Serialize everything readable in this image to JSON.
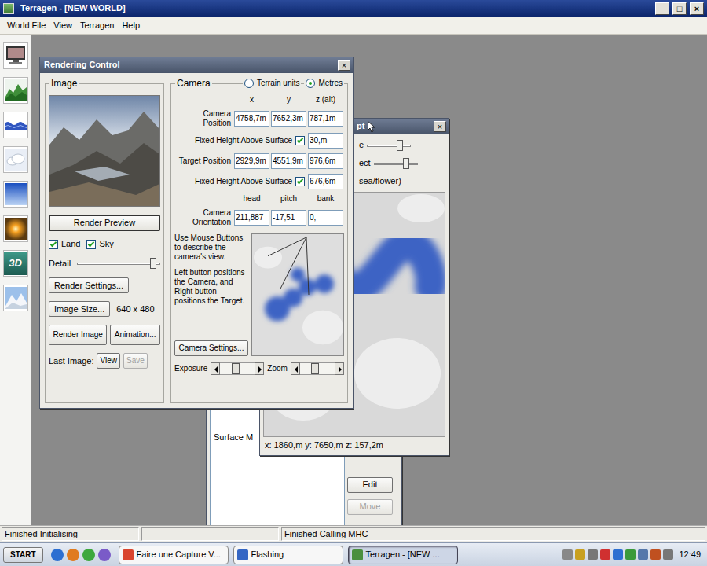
{
  "window": {
    "title": "Terragen - [NEW WORLD]",
    "controls": [
      "_",
      "□",
      "×"
    ]
  },
  "menu": [
    "World File",
    "View",
    "Terragen",
    "Help"
  ],
  "toolbar": [
    {
      "kind": "render"
    },
    {
      "kind": "terrain"
    },
    {
      "kind": "water"
    },
    {
      "kind": "cloud"
    },
    {
      "kind": "sky"
    },
    {
      "kind": "sun"
    },
    {
      "kind": "badge",
      "label": "3D"
    },
    {
      "kind": "snow"
    }
  ],
  "rendering_control": {
    "title": "Rendering Control",
    "close": "×",
    "image": {
      "title": "Image",
      "preview_button": "Render Preview",
      "checks": [
        {
          "label": "Land",
          "checked": true
        },
        {
          "label": "Sky",
          "checked": true
        }
      ],
      "detail": {
        "label": "Detail",
        "level": 0.97
      },
      "settings_button": "Render Settings...",
      "size_button": "Image Size...",
      "size": "640 x 480",
      "render_button": "Render Image",
      "animation_button": "Animation...",
      "last_image": {
        "label": "Last Image:",
        "buttons": [
          {
            "label": "View",
            "disabled": false
          },
          {
            "label": "Save",
            "disabled": true
          }
        ]
      }
    },
    "camera": {
      "title": "Camera",
      "units": [
        {
          "label": "Terrain units",
          "selected": false
        },
        {
          "label": "Metres",
          "selected": true
        }
      ],
      "columns": [
        "x",
        "y",
        "z (alt)"
      ],
      "rows": [
        {
          "kind": "position",
          "label": "Camera Position",
          "values": [
            "4758,7m",
            "7652,3m",
            "787,1m"
          ]
        },
        {
          "kind": "height",
          "label": "Fixed Height Above Surface",
          "checked": true,
          "value": "30,m"
        },
        {
          "kind": "position",
          "label": "Target Position",
          "values": [
            "2929,9m",
            "4551,9m",
            "976,6m"
          ]
        },
        {
          "kind": "height",
          "label": "Fixed Height Above Surface",
          "checked": true,
          "value": "676,6m"
        }
      ],
      "orientation": {
        "label": "Camera Orientation",
        "columns": [
          "head",
          "pitch",
          "bank"
        ],
        "values": [
          "211,887",
          "-17,51",
          "0,"
        ]
      },
      "help": "Use Mouse Buttons to describe the camera's view.",
      "help2": "Left button positions the Camera, and Right button positions the Target.",
      "settings_button": "Camera Settings...",
      "sliders": [
        {
          "label": "Exposure",
          "level": 0.45
        },
        {
          "label": "Zoom",
          "level": 0.45
        }
      ]
    }
  },
  "landscape_window": {
    "title": "pt",
    "close": "×",
    "sliders": [
      {
        "label": "e",
        "level": 0.82
      },
      {
        "label": "ect",
        "level": 0.82
      }
    ],
    "caption": "sea/flower)",
    "coords": "x: 1860,m y: 7650,m z: 157,2m"
  },
  "surface_window": {
    "list": [
      "Surface M"
    ],
    "buttons": [
      {
        "label": "Edit",
        "disabled": false
      },
      {
        "label": "Move",
        "disabled": true
      }
    ]
  },
  "status_bar": [
    "Finished Initialising",
    "Finished Calling MHC"
  ],
  "taskbar": {
    "start": "START",
    "tasks": [
      {
        "label": "Faire une Capture V...",
        "selected": false
      },
      {
        "label": "Flashing",
        "selected": false
      },
      {
        "label": "Terragen - [NEW ...",
        "selected": true
      }
    ],
    "clock": "12:49"
  }
}
